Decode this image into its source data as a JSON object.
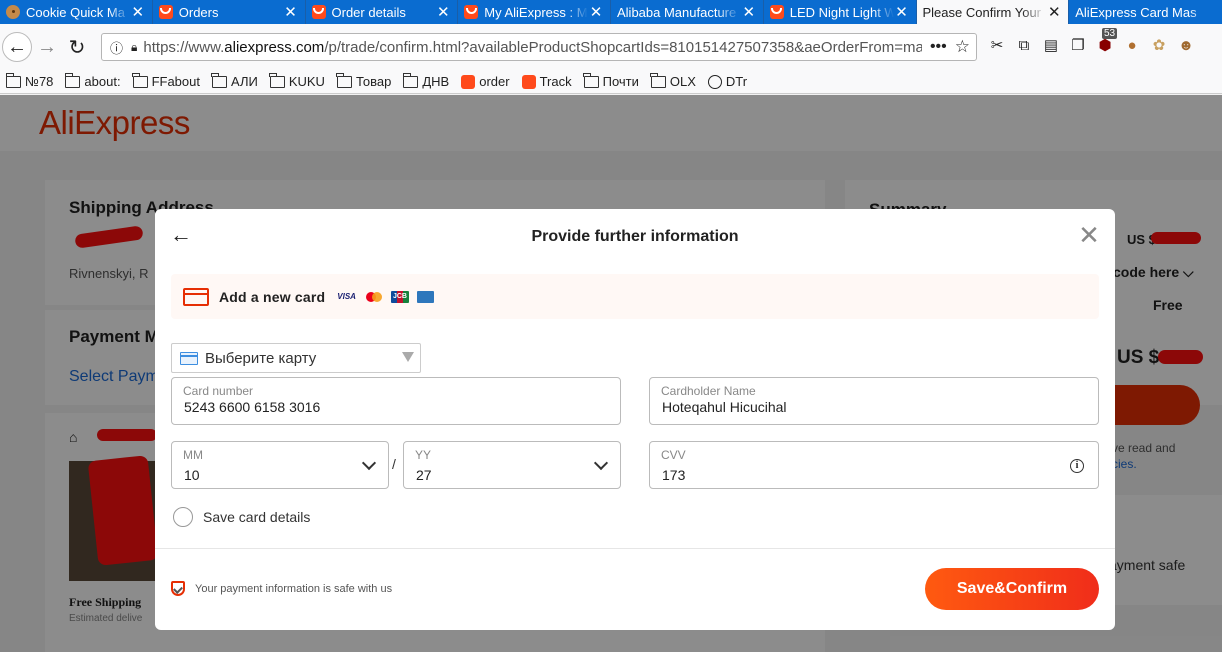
{
  "browser": {
    "tabs": [
      {
        "title": "Cookie Quick Ma",
        "icon": "cookie-icon"
      },
      {
        "title": "Orders",
        "icon": "aliexpress-icon"
      },
      {
        "title": "Order details",
        "icon": "aliexpress-icon"
      },
      {
        "title": "My AliExpress : M",
        "icon": "aliexpress-icon"
      },
      {
        "title": "Alibaba Manufacture",
        "icon": "none"
      },
      {
        "title": "LED Night Light W",
        "icon": "aliexpress-icon"
      },
      {
        "title": "Please Confirm Your",
        "icon": "none",
        "active": true
      },
      {
        "title": "AliExpress Card Mas",
        "icon": "none"
      }
    ],
    "url_prefix": "https://www.",
    "url_domain": "aliexpress.com",
    "url_rest": "/p/trade/confirm.html?availableProductShopcartIds=810151427507358&aeOrderFrom=ma",
    "ext_badge": "53",
    "bookmarks": [
      {
        "label": "№78",
        "icon": "folder"
      },
      {
        "label": "about:",
        "icon": "folder"
      },
      {
        "label": "FFabout",
        "icon": "folder"
      },
      {
        "label": "АЛИ",
        "icon": "folder"
      },
      {
        "label": "KUKU",
        "icon": "folder"
      },
      {
        "label": "Товар",
        "icon": "folder"
      },
      {
        "label": "ДНВ",
        "icon": "folder"
      },
      {
        "label": "order",
        "icon": "cart"
      },
      {
        "label": "Track",
        "icon": "aliexpress"
      },
      {
        "label": "Почти",
        "icon": "folder"
      },
      {
        "label": "OLX",
        "icon": "folder"
      },
      {
        "label": "DTr",
        "icon": "globe"
      }
    ]
  },
  "page": {
    "logo": "AliExpress",
    "shipping_title": "Shipping Address",
    "address_line": "Rivnenskyi, R",
    "payment_title": "Payment M",
    "select_payment": "Select Paym",
    "free_shipping": "Free Shipping",
    "estimated": "Estimated delive",
    "summary_title": "Summary",
    "price_top": "US $",
    "promo": "code here",
    "shipping_cost": "Free",
    "total": "US $",
    "terms_1": "ve read and",
    "terms_2": "cies.",
    "payment_safe": "ayment safe"
  },
  "modal": {
    "title": "Provide further information",
    "new_card_label": "Add a new card",
    "select_card": "Выберите карту",
    "card_number_label": "Card number",
    "card_number": "5243 6600 6158 3016",
    "cardholder_label": "Cardholder Name",
    "cardholder": "Hoteqahul Hicucihal",
    "mm_label": "MM",
    "mm": "10",
    "yy_label": "YY",
    "yy": "27",
    "cvv_label": "CVV",
    "cvv": "173",
    "save_label": "Save card details",
    "safe_text": "Your payment information is safe with us",
    "confirm_label": "Save&Confirm"
  },
  "colors": {
    "brand": "#e62e04",
    "button": "#ff4a1b",
    "tabbar": "#0a6cd0"
  }
}
